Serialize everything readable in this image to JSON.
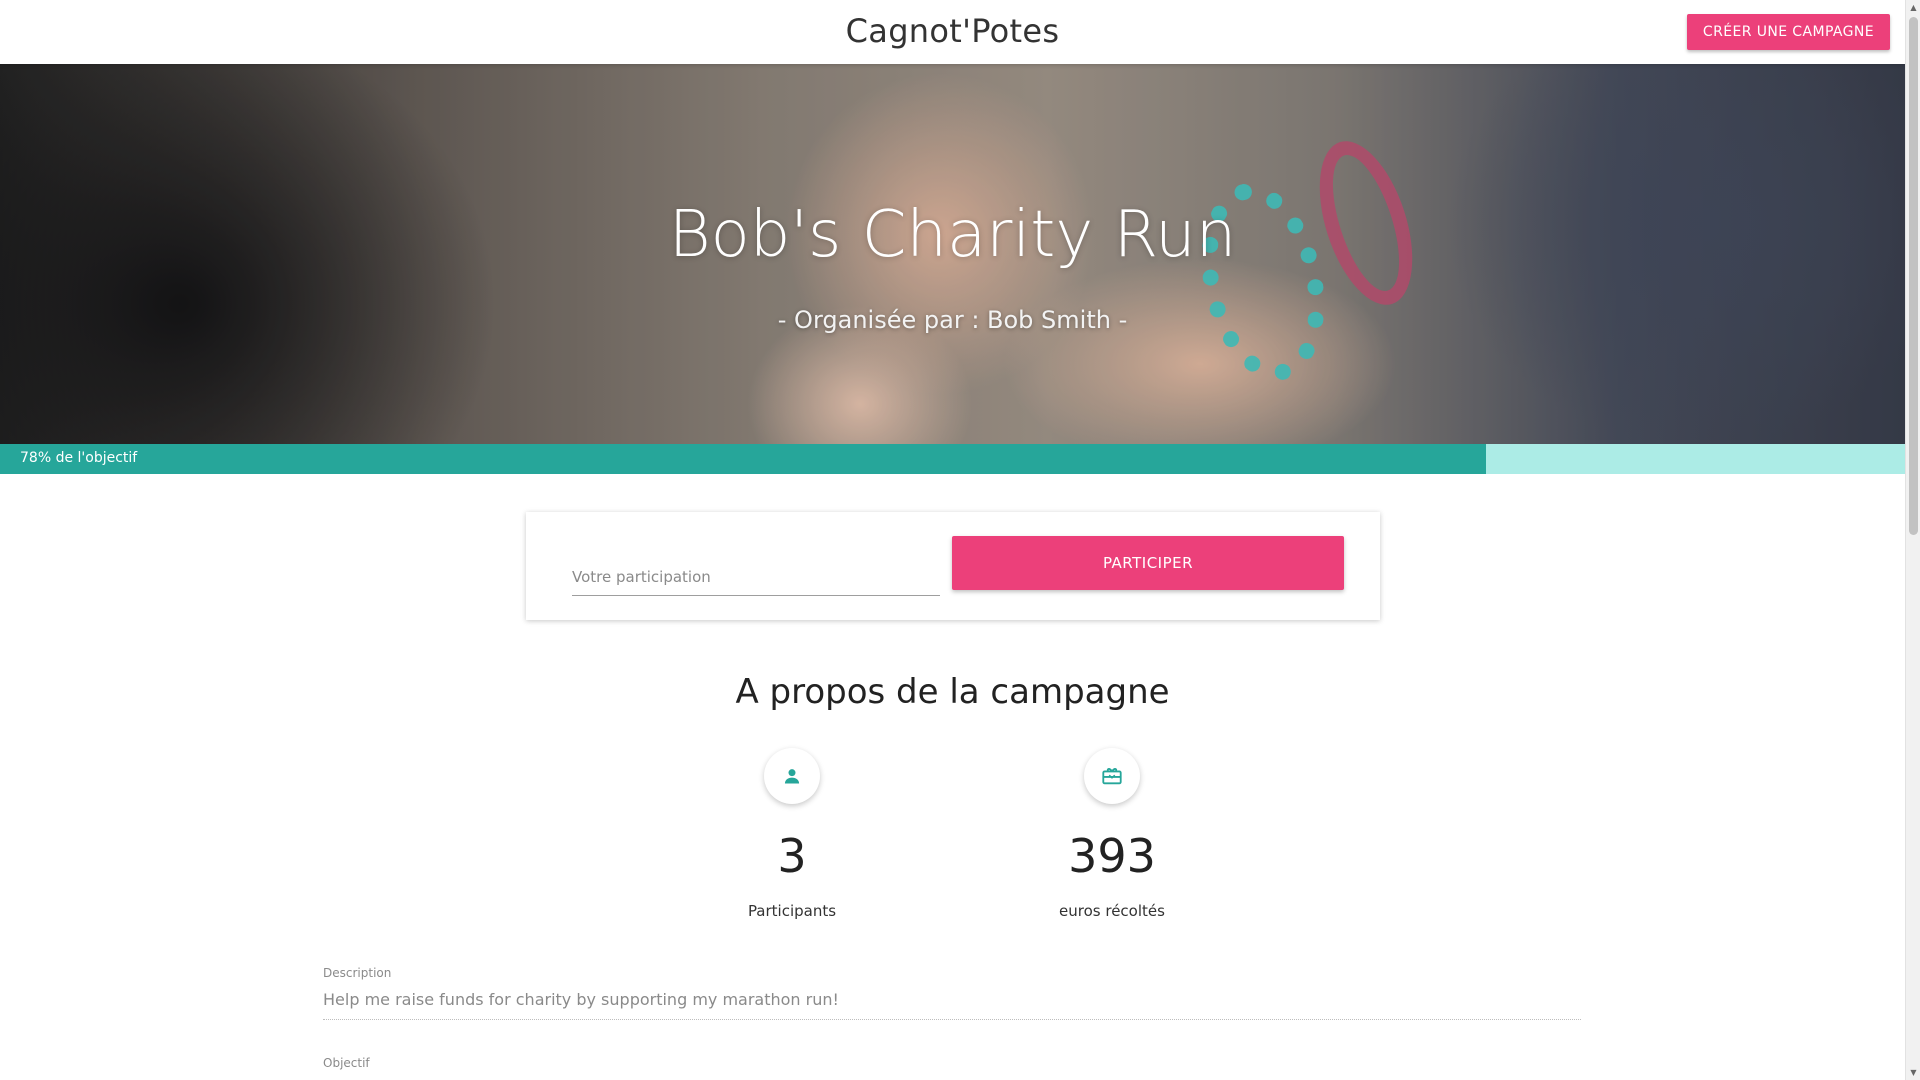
{
  "header": {
    "brand": "Cagnot'Potes",
    "create_button": "CRÉER UNE CAMPAGNE"
  },
  "hero": {
    "title": "Bob's Charity Run",
    "organizer": "- Organisée par : Bob Smith -"
  },
  "progress": {
    "percent": 78,
    "label": "78% de l'objectif",
    "fill_color": "#26a69a",
    "track_color": "#acece6"
  },
  "participation": {
    "placeholder": "Votre participation",
    "value": "",
    "button_label": "PARTICIPER"
  },
  "about": {
    "title": "A propos de la campagne",
    "stats": [
      {
        "icon": "person-icon",
        "value": "3",
        "label": "Participants"
      },
      {
        "icon": "gift-card-icon",
        "value": "393",
        "label": "euros récoltés"
      }
    ]
  },
  "fields": {
    "description_label": "Description",
    "description_value": "Help me raise funds for charity by supporting my marathon run!",
    "objective_label": "Objectif"
  },
  "colors": {
    "accent": "#ec407a",
    "teal": "#26a69a"
  },
  "icons": {
    "scroll_up": "▲",
    "scroll_down": "▼"
  }
}
